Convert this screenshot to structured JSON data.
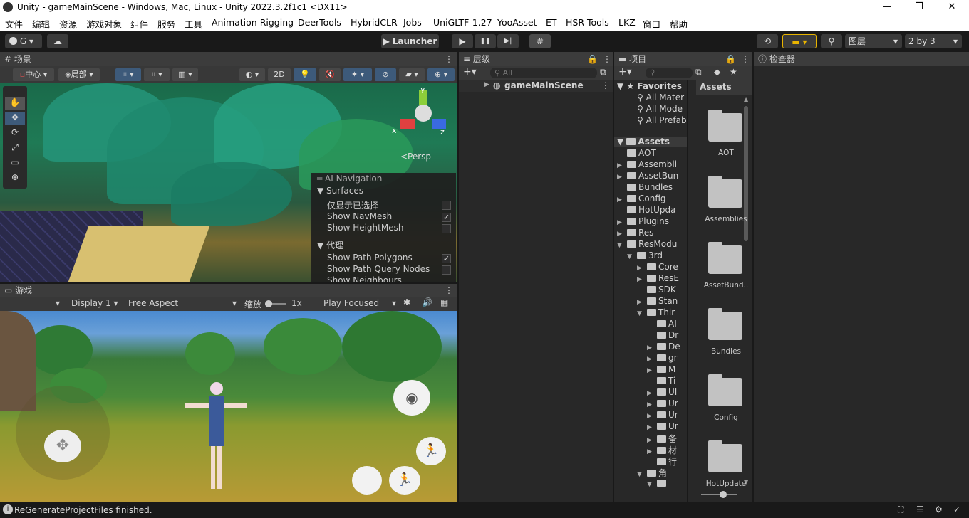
{
  "window": {
    "title": "Unity - gameMainScene - Windows, Mac, Linux - Unity 2022.3.2f1c1 <DX11>",
    "minimize": "—",
    "maximize": "❐",
    "close": "✕"
  },
  "menu": [
    "文件",
    "编辑",
    "资源",
    "游戏对象",
    "组件",
    "服务",
    "工具",
    "Animation Rigging",
    "DeerTools",
    "HybridCLR",
    "Jobs",
    "UniGLTF-1.27",
    "YooAsset",
    "ET",
    "HSR Tools",
    "LKZ",
    "窗口",
    "帮助"
  ],
  "toolbar": {
    "account": "G",
    "launcher": "Launcher",
    "layers": "图层",
    "layout": "2 by 3",
    "play": "▶",
    "pause": "❚❚",
    "step": "▶|",
    "grid": "#"
  },
  "scene": {
    "tab": "场景",
    "pivot": "中心",
    "local": "局部",
    "mode2d": "2D",
    "persp": "<Persp",
    "gizmo_y": "y",
    "gizmo_x": "x",
    "gizmo_z": "z"
  },
  "ai_nav": {
    "title": "AI Navigation",
    "surfaces": "Surfaces",
    "items": [
      {
        "label": "仅显示已选择",
        "checked": ""
      },
      {
        "label": "Show NavMesh",
        "checked": "✓"
      },
      {
        "label": "Show HeightMesh",
        "checked": ""
      }
    ],
    "agents": "代理",
    "agent_items": [
      {
        "label": "Show Path Polygons",
        "checked": "✓"
      },
      {
        "label": "Show Path Query Nodes",
        "checked": ""
      },
      {
        "label": "Show Neighbours",
        "checked": ""
      }
    ]
  },
  "game": {
    "tab": "游戏",
    "display": "Display 1",
    "aspect": "Free Aspect",
    "scale_label": "缩放",
    "scale_value": "1x",
    "play_focused": "Play Focused"
  },
  "hierarchy": {
    "tab": "层级",
    "search_placeholder": "All",
    "root": "gameMainScene"
  },
  "project": {
    "tab": "项目",
    "favorites": "Favorites",
    "fav_items": [
      "All Mater",
      "All Mode",
      "All Prefab"
    ],
    "assets_root": "Assets",
    "breadcrumb": "Assets",
    "tree": [
      {
        "label": "AOT",
        "indent": 0,
        "arrow": ""
      },
      {
        "label": "Assembli",
        "indent": 0,
        "arrow": "▶"
      },
      {
        "label": "AssetBun",
        "indent": 0,
        "arrow": "▶"
      },
      {
        "label": "Bundles",
        "indent": 0,
        "arrow": ""
      },
      {
        "label": "Config",
        "indent": 0,
        "arrow": "▶"
      },
      {
        "label": "HotUpda",
        "indent": 0,
        "arrow": ""
      },
      {
        "label": "Plugins",
        "indent": 0,
        "arrow": "▶"
      },
      {
        "label": "Res",
        "indent": 0,
        "arrow": "▶"
      },
      {
        "label": "ResModu",
        "indent": 0,
        "arrow": "▼"
      },
      {
        "label": "3rd",
        "indent": 1,
        "arrow": "▼"
      },
      {
        "label": "Core",
        "indent": 2,
        "arrow": "▶"
      },
      {
        "label": "ResE",
        "indent": 2,
        "arrow": "▶"
      },
      {
        "label": "SDK",
        "indent": 2,
        "arrow": ""
      },
      {
        "label": "Stan",
        "indent": 2,
        "arrow": "▶"
      },
      {
        "label": "Thir",
        "indent": 2,
        "arrow": "▼"
      },
      {
        "label": "AI",
        "indent": 3,
        "arrow": ""
      },
      {
        "label": "Dr",
        "indent": 3,
        "arrow": ""
      },
      {
        "label": "De",
        "indent": 3,
        "arrow": "▶"
      },
      {
        "label": "gr",
        "indent": 3,
        "arrow": "▶"
      },
      {
        "label": "M",
        "indent": 3,
        "arrow": "▶"
      },
      {
        "label": "Ti",
        "indent": 3,
        "arrow": ""
      },
      {
        "label": "UI",
        "indent": 3,
        "arrow": "▶"
      },
      {
        "label": "Ur",
        "indent": 3,
        "arrow": "▶"
      },
      {
        "label": "Ur",
        "indent": 3,
        "arrow": "▶"
      },
      {
        "label": "Ur",
        "indent": 3,
        "arrow": "▶"
      },
      {
        "label": "备",
        "indent": 3,
        "arrow": "▶"
      },
      {
        "label": "材",
        "indent": 3,
        "arrow": "▶"
      },
      {
        "label": "行",
        "indent": 3,
        "arrow": ""
      },
      {
        "label": "角",
        "indent": 2,
        "arrow": "▼"
      },
      {
        "label": "",
        "indent": 3,
        "arrow": "▼"
      }
    ],
    "grid": [
      "AOT",
      "Assemblies",
      "AssetBund..",
      "Bundles",
      "Config",
      "HotUpdate"
    ]
  },
  "inspector": {
    "tab": "检查器"
  },
  "status": {
    "message": "ReGenerateProjectFiles finished."
  }
}
